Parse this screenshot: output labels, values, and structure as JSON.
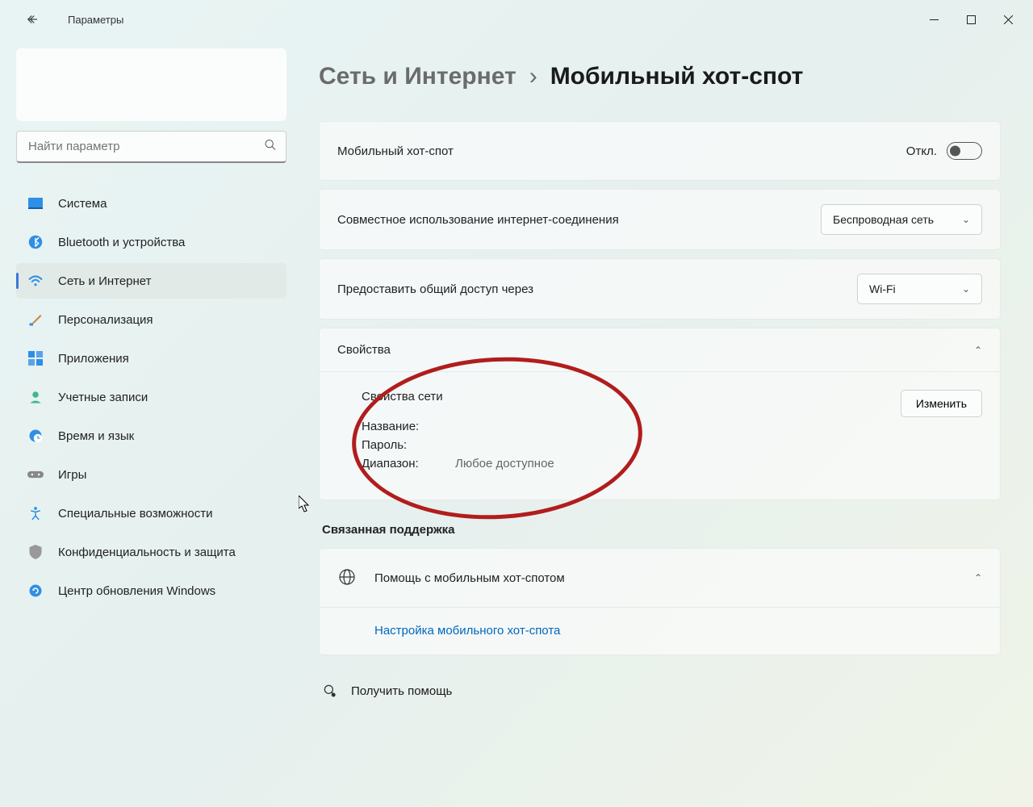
{
  "window": {
    "title": "Параметры"
  },
  "search": {
    "placeholder": "Найти параметр"
  },
  "nav": {
    "items": [
      {
        "label": "Система"
      },
      {
        "label": "Bluetooth и устройства"
      },
      {
        "label": "Сеть и Интернет"
      },
      {
        "label": "Персонализация"
      },
      {
        "label": "Приложения"
      },
      {
        "label": "Учетные записи"
      },
      {
        "label": "Время и язык"
      },
      {
        "label": "Игры"
      },
      {
        "label": "Специальные возможности"
      },
      {
        "label": "Конфиденциальность и защита"
      },
      {
        "label": "Центр обновления Windows"
      }
    ]
  },
  "breadcrumb": {
    "parent": "Сеть и Интернет",
    "sep": "›",
    "current": "Мобильный хот-спот"
  },
  "hotspot": {
    "toggle_label": "Мобильный хот-спот",
    "toggle_state_text": "Откл."
  },
  "share_from": {
    "label": "Совместное использование интернет-соединения",
    "value": "Беспроводная сеть"
  },
  "share_over": {
    "label": "Предоставить общий доступ через",
    "value": "Wi-Fi"
  },
  "properties": {
    "header": "Свойства",
    "sub": "Свойства сети",
    "name_label": "Название:",
    "name_value": "",
    "password_label": "Пароль:",
    "password_value": "",
    "band_label": "Диапазон:",
    "band_value": "Любое доступное",
    "edit_button": "Изменить"
  },
  "related": {
    "heading": "Связанная поддержка",
    "help_title": "Помощь с мобильным хот-спотом",
    "help_link": "Настройка мобильного хот-спота"
  },
  "footer": {
    "get_help": "Получить помощь"
  }
}
